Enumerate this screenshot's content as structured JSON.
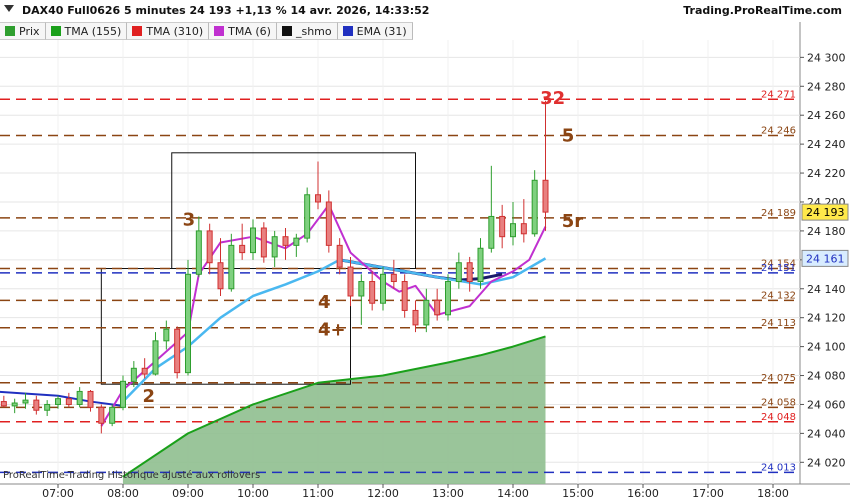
{
  "header": {
    "title": "DAX40 Full0626 5 minutes 24 193 +1,13 % 14 avr. 2026, 14:33:52",
    "source": "Trading.ProRealTime.com"
  },
  "legend": [
    {
      "label": "Prix",
      "color": "#2e9e2e"
    },
    {
      "label": "TMA (155)",
      "color": "#1aa01a"
    },
    {
      "label": "TMA (310)",
      "color": "#e02020"
    },
    {
      "label": "TMA (6)",
      "color": "#c030d0"
    },
    {
      "label": "_shmo",
      "color": "#111111"
    },
    {
      "label": "EMA (31)",
      "color": "#2030c0"
    }
  ],
  "footer": {
    "watermark": "ProRealTime-Trading  Historique ajusté aux rollovers"
  },
  "chart_data": {
    "type": "line",
    "instrument": "DAX40 Full0626",
    "timeframe": "5 minutes",
    "x_ticks": [
      "07:00",
      "08:00",
      "09:00",
      "10:00",
      "11:00",
      "12:00",
      "13:00",
      "14:00",
      "15:00",
      "16:00",
      "17:00",
      "18:00"
    ],
    "y_ticks": [
      24020,
      24040,
      24060,
      24080,
      24100,
      24120,
      24140,
      24160,
      24180,
      24200,
      24220,
      24240,
      24260,
      24280,
      24300
    ],
    "y_tick_labels": [
      "24 020",
      "24 040",
      "24 060",
      "24 080",
      "24 100",
      "24 120",
      "24 140",
      "24 160",
      "24 180",
      "24 200",
      "24 220",
      "24 240",
      "24 260",
      "24 280",
      "24 300"
    ],
    "ylim": [
      24005,
      24312
    ],
    "last_price": {
      "value": 24193,
      "label": "24 193"
    },
    "ema_price": {
      "value": 24161,
      "label": "24 161"
    },
    "levels": [
      {
        "value": 24271,
        "label": "24 271",
        "color": "#e02020",
        "style": "dashed"
      },
      {
        "value": 24246,
        "label": "24 246",
        "color": "#8b4513",
        "style": "dashed"
      },
      {
        "value": 24189,
        "label": "24 189",
        "color": "#8b4513",
        "style": "dashed"
      },
      {
        "value": 24154,
        "label": "24 154",
        "color": "#8b4513",
        "style": "dashed"
      },
      {
        "value": 24151,
        "label": "24 151",
        "color": "#2030c0",
        "style": "dashed"
      },
      {
        "value": 24132,
        "label": "24 132",
        "color": "#8b4513",
        "style": "dashed"
      },
      {
        "value": 24113,
        "label": "24 113",
        "color": "#8b4513",
        "style": "dashed"
      },
      {
        "value": 24075,
        "label": "24 075",
        "color": "#8b4513",
        "style": "dashed"
      },
      {
        "value": 24058,
        "label": "24 058",
        "color": "#8b4513",
        "style": "dashed"
      },
      {
        "value": 24048,
        "label": "24 048",
        "color": "#e02020",
        "style": "dashed"
      },
      {
        "value": 24013,
        "label": "24 013",
        "color": "#2030c0",
        "style": "dashed"
      }
    ],
    "annotations": [
      {
        "text": "32",
        "x": "14:25",
        "y": 24272,
        "color": "#e03030"
      },
      {
        "text": "5",
        "x": "14:45",
        "y": 24246,
        "color": "#8b4513"
      },
      {
        "text": "5r",
        "x": "14:45",
        "y": 24187,
        "color": "#8b4513"
      },
      {
        "text": "3",
        "x": "08:55",
        "y": 24188,
        "color": "#8b4513"
      },
      {
        "text": "4",
        "x": "11:00",
        "y": 24131,
        "color": "#8b4513"
      },
      {
        "text": "4+",
        "x": "11:00",
        "y": 24112,
        "color": "#8b4513"
      },
      {
        "text": "2",
        "x": "08:18",
        "y": 24066,
        "color": "#8b4513"
      }
    ],
    "boxes": [
      {
        "x0": "07:40",
        "x1": "11:30",
        "y0": 24074,
        "y1": 24154
      },
      {
        "x0": "08:45",
        "x1": "12:30",
        "y0": 24154,
        "y1": 24234
      }
    ],
    "series": [
      {
        "name": "TMA (155)",
        "color": "#1aa01a",
        "fill": "#8fbf8f",
        "x": [
          "08:00",
          "09:00",
          "10:00",
          "11:00",
          "12:00",
          "13:00",
          "13:30",
          "14:00",
          "14:30"
        ],
        "y": [
          24010,
          24040,
          24060,
          24075,
          24080,
          24089,
          24094,
          24100,
          24107
        ]
      },
      {
        "name": "EMA (31)",
        "color": "#2030c0",
        "x": [
          "06:00",
          "07:00",
          "07:30",
          "08:00"
        ],
        "y": [
          24069,
          24066,
          24062,
          24059
        ]
      },
      {
        "name": "_shmo",
        "color": "#1a1a6a",
        "x": [
          "11:20",
          "11:50",
          "12:20",
          "12:50",
          "13:10",
          "13:30",
          "13:50"
        ],
        "y": [
          24160,
          24156,
          24152,
          24148,
          24146,
          24147,
          24150
        ]
      },
      {
        "name": "ema_light",
        "color": "#4ab8f0",
        "x": [
          "08:00",
          "08:30",
          "09:00",
          "09:30",
          "10:00",
          "10:30",
          "11:00",
          "11:20",
          "11:50",
          "12:20",
          "12:50",
          "13:30",
          "14:00",
          "14:30"
        ],
        "y": [
          24062,
          24085,
          24100,
          24120,
          24135,
          24143,
          24152,
          24160,
          24156,
          24152,
          24148,
          24143,
          24148,
          24161
        ]
      },
      {
        "name": "TMA (6)",
        "color": "#c030d0",
        "x": [
          "07:40",
          "08:00",
          "08:30",
          "09:00",
          "09:10",
          "09:30",
          "10:00",
          "10:30",
          "10:50",
          "11:10",
          "11:30",
          "12:00",
          "12:15",
          "12:30",
          "12:50",
          "13:20",
          "13:40",
          "14:00",
          "14:15",
          "14:30"
        ],
        "y": [
          24045,
          24070,
          24090,
          24110,
          24150,
          24172,
          24176,
          24168,
          24178,
          24198,
          24165,
          24145,
          24138,
          24142,
          24122,
          24128,
          24145,
          24152,
          24160,
          24183
        ]
      }
    ],
    "candles": [
      {
        "t": "06:00",
        "o": 24060,
        "h": 24064,
        "l": 24055,
        "c": 24062
      },
      {
        "t": "06:10",
        "o": 24062,
        "h": 24066,
        "l": 24058,
        "c": 24059
      },
      {
        "t": "06:20",
        "o": 24059,
        "h": 24064,
        "l": 24054,
        "c": 24061
      },
      {
        "t": "06:30",
        "o": 24061,
        "h": 24068,
        "l": 24057,
        "c": 24063
      },
      {
        "t": "06:40",
        "o": 24063,
        "h": 24066,
        "l": 24053,
        "c": 24056
      },
      {
        "t": "06:50",
        "o": 24056,
        "h": 24063,
        "l": 24052,
        "c": 24060
      },
      {
        "t": "07:00",
        "o": 24060,
        "h": 24066,
        "l": 24057,
        "c": 24064
      },
      {
        "t": "07:10",
        "o": 24064,
        "h": 24068,
        "l": 24058,
        "c": 24060
      },
      {
        "t": "07:20",
        "o": 24060,
        "h": 24072,
        "l": 24058,
        "c": 24069
      },
      {
        "t": "07:30",
        "o": 24069,
        "h": 24070,
        "l": 24055,
        "c": 24058
      },
      {
        "t": "07:40",
        "o": 24058,
        "h": 24060,
        "l": 24040,
        "c": 24047
      },
      {
        "t": "07:50",
        "o": 24047,
        "h": 24060,
        "l": 24045,
        "c": 24058
      },
      {
        "t": "08:00",
        "o": 24058,
        "h": 24080,
        "l": 24056,
        "c": 24076
      },
      {
        "t": "08:10",
        "o": 24076,
        "h": 24090,
        "l": 24072,
        "c": 24085
      },
      {
        "t": "08:20",
        "o": 24085,
        "h": 24092,
        "l": 24078,
        "c": 24081
      },
      {
        "t": "08:30",
        "o": 24081,
        "h": 24110,
        "l": 24080,
        "c": 24104
      },
      {
        "t": "08:40",
        "o": 24104,
        "h": 24118,
        "l": 24098,
        "c": 24112
      },
      {
        "t": "08:50",
        "o": 24112,
        "h": 24114,
        "l": 24078,
        "c": 24082
      },
      {
        "t": "09:00",
        "o": 24082,
        "h": 24160,
        "l": 24080,
        "c": 24150
      },
      {
        "t": "09:10",
        "o": 24150,
        "h": 24190,
        "l": 24148,
        "c": 24180
      },
      {
        "t": "09:20",
        "o": 24180,
        "h": 24185,
        "l": 24150,
        "c": 24158
      },
      {
        "t": "09:30",
        "o": 24158,
        "h": 24175,
        "l": 24135,
        "c": 24140
      },
      {
        "t": "09:40",
        "o": 24140,
        "h": 24178,
        "l": 24138,
        "c": 24170
      },
      {
        "t": "09:50",
        "o": 24170,
        "h": 24185,
        "l": 24160,
        "c": 24165
      },
      {
        "t": "10:00",
        "o": 24165,
        "h": 24188,
        "l": 24160,
        "c": 24182
      },
      {
        "t": "10:10",
        "o": 24182,
        "h": 24186,
        "l": 24158,
        "c": 24162
      },
      {
        "t": "10:20",
        "o": 24162,
        "h": 24180,
        "l": 24155,
        "c": 24176
      },
      {
        "t": "10:30",
        "o": 24176,
        "h": 24182,
        "l": 24160,
        "c": 24170
      },
      {
        "t": "10:40",
        "o": 24170,
        "h": 24178,
        "l": 24162,
        "c": 24175
      },
      {
        "t": "10:50",
        "o": 24175,
        "h": 24210,
        "l": 24172,
        "c": 24205
      },
      {
        "t": "11:00",
        "o": 24205,
        "h": 24228,
        "l": 24195,
        "c": 24200
      },
      {
        "t": "11:10",
        "o": 24200,
        "h": 24208,
        "l": 24165,
        "c": 24170
      },
      {
        "t": "11:20",
        "o": 24170,
        "h": 24175,
        "l": 24150,
        "c": 24155
      },
      {
        "t": "11:30",
        "o": 24155,
        "h": 24162,
        "l": 24128,
        "c": 24135
      },
      {
        "t": "11:40",
        "o": 24135,
        "h": 24150,
        "l": 24115,
        "c": 24145
      },
      {
        "t": "11:50",
        "o": 24145,
        "h": 24152,
        "l": 24125,
        "c": 24130
      },
      {
        "t": "12:00",
        "o": 24130,
        "h": 24155,
        "l": 24125,
        "c": 24150
      },
      {
        "t": "12:10",
        "o": 24150,
        "h": 24160,
        "l": 24140,
        "c": 24145
      },
      {
        "t": "12:20",
        "o": 24145,
        "h": 24150,
        "l": 24120,
        "c": 24125
      },
      {
        "t": "12:30",
        "o": 24125,
        "h": 24132,
        "l": 24110,
        "c": 24115
      },
      {
        "t": "12:40",
        "o": 24115,
        "h": 24140,
        "l": 24110,
        "c": 24132
      },
      {
        "t": "12:50",
        "o": 24132,
        "h": 24140,
        "l": 24118,
        "c": 24122
      },
      {
        "t": "13:00",
        "o": 24122,
        "h": 24150,
        "l": 24118,
        "c": 24145
      },
      {
        "t": "13:10",
        "o": 24145,
        "h": 24165,
        "l": 24140,
        "c": 24158
      },
      {
        "t": "13:20",
        "o": 24158,
        "h": 24162,
        "l": 24138,
        "c": 24145
      },
      {
        "t": "13:30",
        "o": 24145,
        "h": 24175,
        "l": 24140,
        "c": 24168
      },
      {
        "t": "13:40",
        "o": 24168,
        "h": 24225,
        "l": 24165,
        "c": 24190
      },
      {
        "t": "13:50",
        "o": 24190,
        "h": 24198,
        "l": 24168,
        "c": 24176
      },
      {
        "t": "14:00",
        "o": 24176,
        "h": 24200,
        "l": 24170,
        "c": 24185
      },
      {
        "t": "14:10",
        "o": 24185,
        "h": 24202,
        "l": 24172,
        "c": 24178
      },
      {
        "t": "14:20",
        "o": 24178,
        "h": 24222,
        "l": 24176,
        "c": 24215
      },
      {
        "t": "14:30",
        "o": 24215,
        "h": 24270,
        "l": 24180,
        "c": 24193
      }
    ]
  }
}
